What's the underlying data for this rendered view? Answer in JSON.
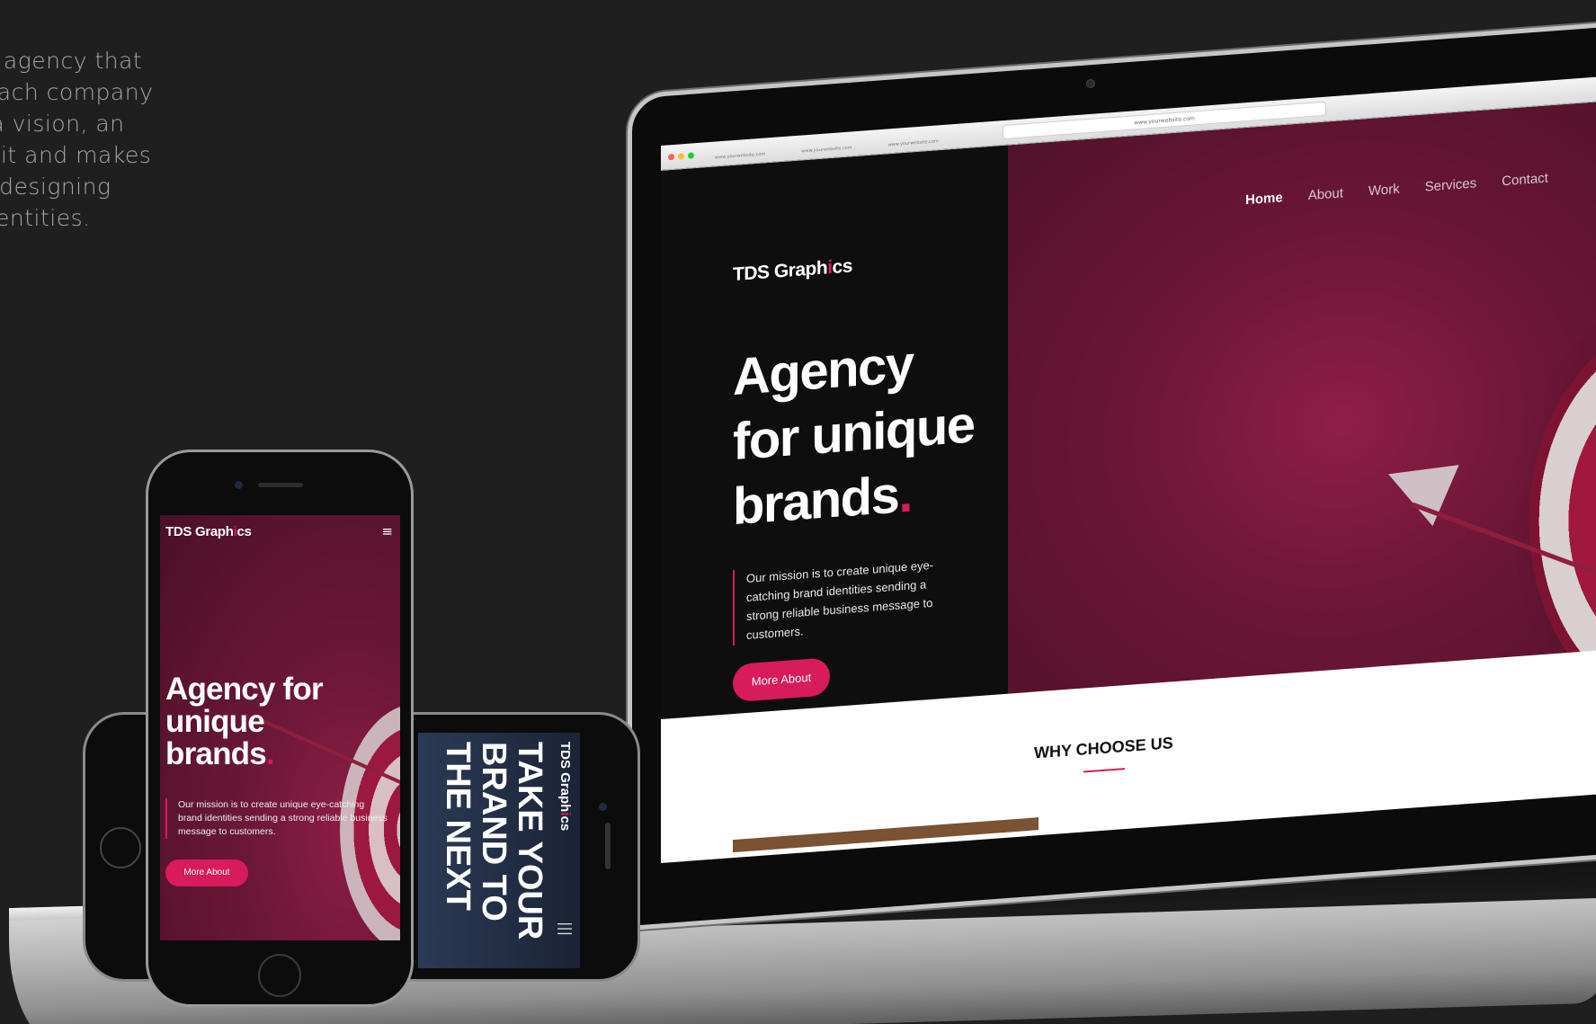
{
  "intro": {
    "lines": [
      "eting agency that",
      "hat each company",
      "ure, a vision, an",
      "fines it and makes",
      "n for designing",
      "nd identities."
    ]
  },
  "browser": {
    "address": "www.yourwebsite.com",
    "tabs": [
      "www.yourwebsite.com",
      "www.yourwebsite.com",
      "www.yourwebsite.com"
    ]
  },
  "site": {
    "brand_main": "TDS Graph",
    "brand_dot": "i",
    "brand_end": "cs",
    "nav": [
      "Home",
      "About",
      "Work",
      "Services",
      "Contact"
    ],
    "active_nav": "Home",
    "hero_title_1": "Agency",
    "hero_title_2": "for unique",
    "hero_title_3": "brands",
    "hero_title_dot": ".",
    "mission": "Our mission is to create unique eye-catching brand identities sending a strong reliable business message to customers.",
    "cta": "More About",
    "why_title": "WHY CHOOSE US"
  },
  "mobile": {
    "brand_main": "TDS Graph",
    "brand_dot": "i",
    "brand_end": "cs",
    "menu_icon": "≡",
    "title_1": "Agency for",
    "title_2": "unique",
    "title_3": "brands",
    "title_dot": ".",
    "mission": "Our mission is to create unique eye-catching brand identities sending a strong reliable business message to customers.",
    "cta": "More About"
  },
  "landscape": {
    "brand_main": "TDS Graph",
    "brand_dot": "i",
    "brand_end": "cs",
    "headline": "TAKE YOUR BRAND TO THE NEXT",
    "menu_icon": "|||"
  },
  "colors": {
    "accent": "#d81b5a",
    "hero_bg": "#6c1637",
    "page_bg": "#1f1f1f"
  }
}
